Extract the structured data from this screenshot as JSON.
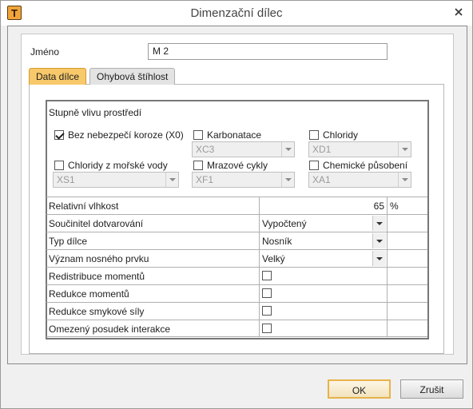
{
  "window": {
    "title": "Dimenzační dílec",
    "icon_letter": "T",
    "close_icon": "close-icon"
  },
  "name": {
    "label": "Jméno",
    "value": "M 2"
  },
  "tabs": [
    {
      "label": "Data dílce",
      "active": true
    },
    {
      "label": "Ohybová štíhlost",
      "active": false
    }
  ],
  "environment": {
    "title": "Stupně vlivu prostředí",
    "items": [
      {
        "label": "Bez nebezpečí koroze (X0)",
        "checked": true,
        "select": ""
      },
      {
        "label": "Karbonatace",
        "checked": false,
        "select": "XC3"
      },
      {
        "label": "Chloridy",
        "checked": false,
        "select": "XD1"
      },
      {
        "label": "Chloridy z mořské vody",
        "checked": false,
        "select": "XS1"
      },
      {
        "label": "Mrazové cykly",
        "checked": false,
        "select": "XF1"
      },
      {
        "label": "Chemické působení",
        "checked": false,
        "select": "XA1"
      }
    ]
  },
  "properties": {
    "humidity": {
      "label": "Relativní vlhkost",
      "value": "65",
      "unit": "%"
    },
    "creep": {
      "label": "Součinitel dotvarování",
      "value": "Vypočtený"
    },
    "member_type": {
      "label": "Typ dílce",
      "value": "Nosník"
    },
    "importance": {
      "label": "Význam nosného prvku",
      "value": "Velký"
    },
    "checks": [
      {
        "label": "Redistribuce momentů",
        "checked": false
      },
      {
        "label": "Redukce momentů",
        "checked": false
      },
      {
        "label": "Redukce smykové síly",
        "checked": false
      },
      {
        "label": "Omezený posudek interakce",
        "checked": false
      }
    ]
  },
  "buttons": {
    "ok": "OK",
    "cancel": "Zrušit"
  },
  "colors": {
    "active_tab": "#f7c96b",
    "ok_border": "#e8b24a"
  }
}
